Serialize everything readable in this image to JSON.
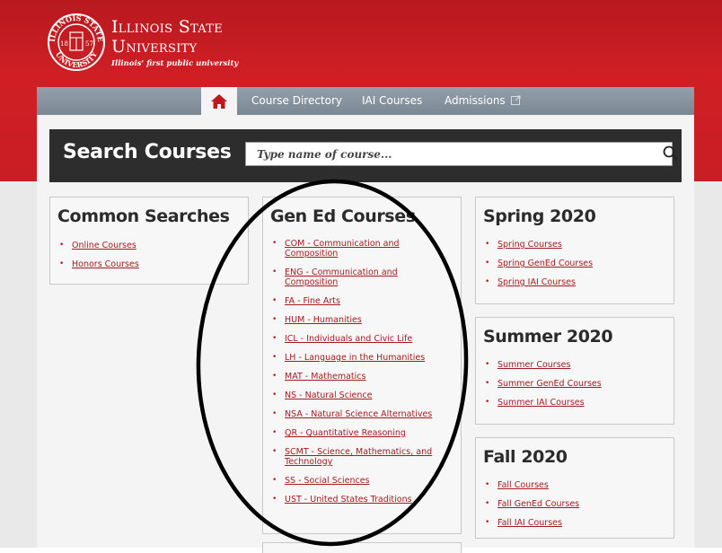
{
  "header": {
    "university_line1": "Illinois State",
    "university_line2": "University",
    "tagline": "Illinois' first public university",
    "seal_text_top": "ILLINOIS STATE",
    "seal_text_bottom": "UNIVERSITY",
    "seal_year_left": "18",
    "seal_year_right": "57"
  },
  "nav": {
    "home_icon": "home-icon",
    "items": [
      {
        "label": "Course Directory"
      },
      {
        "label": "IAI Courses"
      },
      {
        "label": "Admissions"
      }
    ],
    "external_icon": "external-link-icon"
  },
  "search": {
    "title": "Search Courses",
    "placeholder": "Type name of course...",
    "value": "",
    "icon": "search-icon"
  },
  "cards": {
    "common": {
      "title": "Common Searches",
      "links": [
        "Online Courses",
        "Honors Courses"
      ]
    },
    "gened": {
      "title": "Gen Ed Courses",
      "links": [
        "COM - Communication and Composition",
        "ENG - Communication and Composition",
        "FA - Fine Arts",
        "HUM - Humanities",
        "ICL - Individuals and Civic Life",
        "LH - Language in the Humanities",
        "MAT - Mathematics",
        "NS - Natural Science",
        "NSA - Natural Science Alternatives",
        "QR - Quantitative Reasoning",
        "SCMT - Science, Mathematics, and Technology",
        "SS - Social Sciences",
        "UST - United States Traditions"
      ]
    },
    "spring": {
      "title": "Spring 2020",
      "links": [
        "Spring Courses",
        "Spring GenEd Courses",
        "Spring IAI Courses"
      ]
    },
    "summer": {
      "title": "Summer 2020",
      "links": [
        "Summer Courses",
        "Summer GenEd Courses",
        "Summer IAI Courses"
      ]
    },
    "fall": {
      "title": "Fall 2020",
      "links": [
        "Fall Courses",
        "Fall GenEd Courses",
        "Fall IAI Courses"
      ]
    }
  },
  "colors": {
    "brand_red": "#cf1f25",
    "link_red": "#a31b1f",
    "nav_gray": "#8794a0",
    "search_bar": "#2d2d2d"
  }
}
